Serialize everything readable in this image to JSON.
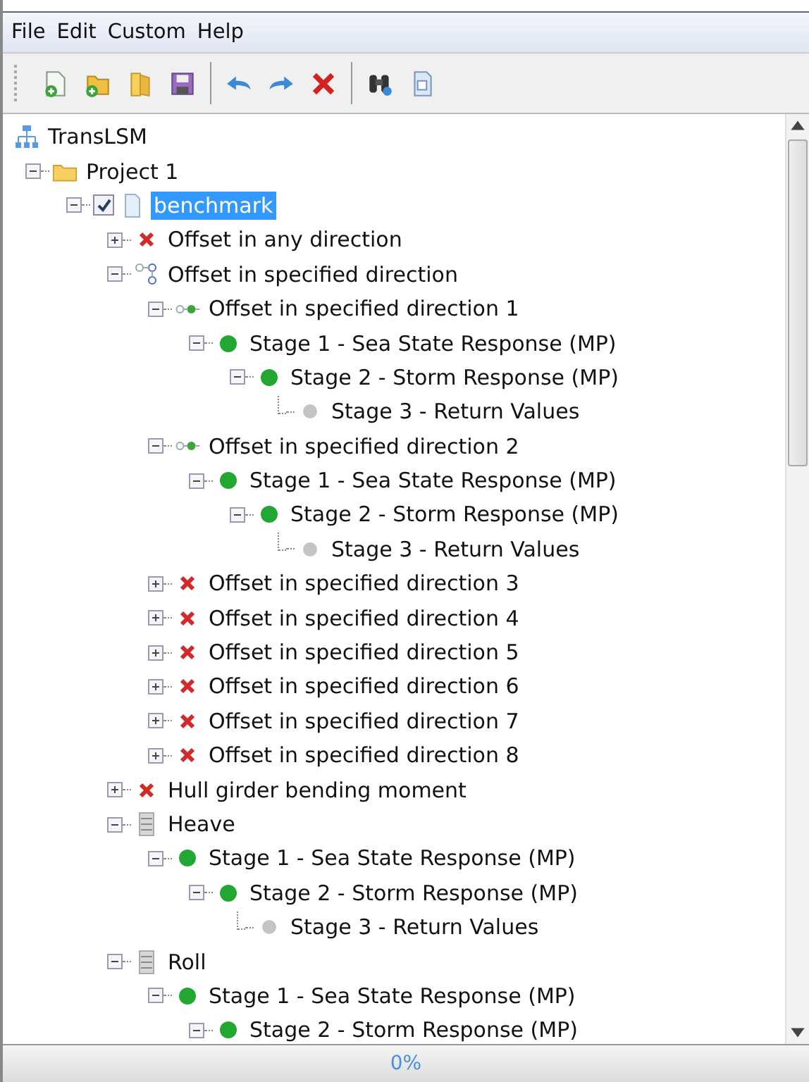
{
  "menu": [
    "File",
    "Edit",
    "Custom",
    "Help"
  ],
  "toolbar": [
    {
      "kind": "new"
    },
    {
      "kind": "open"
    },
    {
      "kind": "folder"
    },
    {
      "kind": "save"
    },
    {
      "kind": "separator"
    },
    {
      "kind": "undo"
    },
    {
      "kind": "redo"
    },
    {
      "kind": "delete"
    },
    {
      "kind": "separator"
    },
    {
      "kind": "find"
    },
    {
      "kind": "report"
    }
  ],
  "tree": [
    {
      "label": "TransLSM",
      "kind": "root",
      "selected": false,
      "children": [
        {
          "label": "Project 1",
          "kind": "folder",
          "expanded": true,
          "selected": false,
          "children": [
            {
              "label": "benchmark",
              "kind": "document",
              "checked": true,
              "expanded": true,
              "selected": true,
              "children": [
                {
                  "label": "Offset in any direction",
                  "kind": "error",
                  "expanded": false,
                  "selected": false
                },
                {
                  "label": "Offset in specified direction",
                  "kind": "group",
                  "expanded": true,
                  "selected": false,
                  "children": [
                    {
                      "label": "Offset in specified direction 1",
                      "kind": "link",
                      "expanded": true,
                      "selected": false,
                      "children": [
                        {
                          "label": "Stage 1 - Sea State Response (MP)",
                          "kind": "ok",
                          "expanded": true,
                          "selected": false,
                          "children": [
                            {
                              "label": "Stage 2 - Storm Response (MP)",
                              "kind": "ok",
                              "expanded": true,
                              "selected": false,
                              "children": [
                                {
                                  "label": "Stage 3 - Return Values",
                                  "kind": "pending",
                                  "selected": false
                                }
                              ]
                            }
                          ]
                        }
                      ]
                    },
                    {
                      "label": "Offset in specified direction 2",
                      "kind": "link",
                      "expanded": true,
                      "selected": false,
                      "children": [
                        {
                          "label": "Stage 1 - Sea State Response (MP)",
                          "kind": "ok",
                          "expanded": true,
                          "selected": false,
                          "children": [
                            {
                              "label": "Stage 2 - Storm Response (MP)",
                              "kind": "ok",
                              "expanded": true,
                              "selected": false,
                              "children": [
                                {
                                  "label": "Stage 3 - Return Values",
                                  "kind": "pending",
                                  "selected": false
                                }
                              ]
                            }
                          ]
                        }
                      ]
                    },
                    {
                      "label": "Offset in specified direction 3",
                      "kind": "error",
                      "expanded": false,
                      "selected": false
                    },
                    {
                      "label": "Offset in specified direction 4",
                      "kind": "error",
                      "expanded": false,
                      "selected": false
                    },
                    {
                      "label": "Offset in specified direction 5",
                      "kind": "error",
                      "expanded": false,
                      "selected": false
                    },
                    {
                      "label": "Offset in specified direction 6",
                      "kind": "error",
                      "expanded": false,
                      "selected": false
                    },
                    {
                      "label": "Offset in specified direction 7",
                      "kind": "error",
                      "expanded": false,
                      "selected": false
                    },
                    {
                      "label": "Offset in specified direction 8",
                      "kind": "error",
                      "expanded": false,
                      "selected": false
                    }
                  ]
                },
                {
                  "label": "Hull girder bending moment",
                  "kind": "error",
                  "expanded": false,
                  "selected": false
                },
                {
                  "label": "Heave",
                  "kind": "list",
                  "expanded": true,
                  "selected": false,
                  "children": [
                    {
                      "label": "Stage 1 - Sea State Response (MP)",
                      "kind": "ok",
                      "expanded": true,
                      "selected": false,
                      "children": [
                        {
                          "label": "Stage 2 - Storm Response (MP)",
                          "kind": "ok",
                          "expanded": true,
                          "selected": false,
                          "children": [
                            {
                              "label": "Stage 3 - Return Values",
                              "kind": "pending",
                              "selected": false
                            }
                          ]
                        }
                      ]
                    }
                  ]
                },
                {
                  "label": "Roll",
                  "kind": "list",
                  "expanded": true,
                  "selected": false,
                  "children": [
                    {
                      "label": "Stage 1 - Sea State Response (MP)",
                      "kind": "ok",
                      "expanded": true,
                      "selected": false,
                      "children": [
                        {
                          "label": "Stage 2 - Storm Response (MP)",
                          "kind": "ok",
                          "expanded": true,
                          "selected": false
                        }
                      ]
                    }
                  ]
                }
              ]
            }
          ]
        }
      ]
    }
  ],
  "progress": {
    "level": 0,
    "text": "0%"
  }
}
